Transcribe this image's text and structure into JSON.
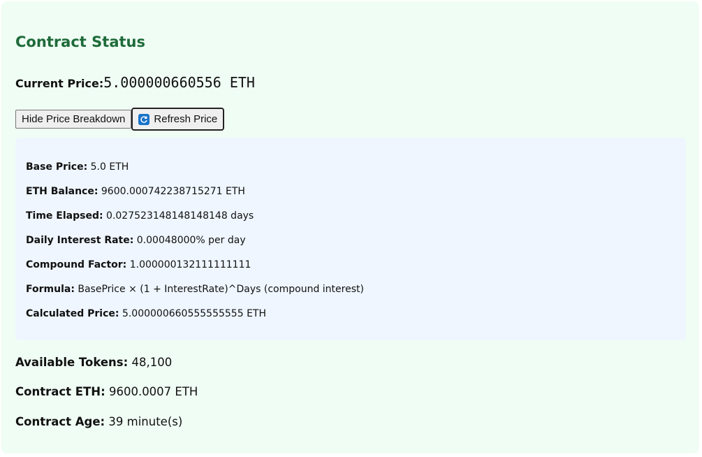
{
  "title": "Contract Status",
  "current_price": {
    "label": "Current Price:",
    "value": "5.000000660556 ETH"
  },
  "buttons": {
    "hide_breakdown": "Hide Price Breakdown",
    "refresh": "Refresh Price",
    "refresh_icon": "refresh-icon"
  },
  "breakdown": {
    "base_price": {
      "label": "Base Price:",
      "value": "5.0 ETH"
    },
    "eth_balance": {
      "label": "ETH Balance:",
      "value": "9600.000742238715271 ETH"
    },
    "time_elapsed": {
      "label": "Time Elapsed:",
      "value": "0.027523148148148148 days"
    },
    "daily_rate": {
      "label": "Daily Interest Rate:",
      "value": "0.00048000% per day"
    },
    "compound_factor": {
      "label": "Compound Factor:",
      "value": "1.000000132111111111"
    },
    "formula": {
      "label": "Formula:",
      "value": "BasePrice × (1 + InterestRate)^Days (compound interest)"
    },
    "calculated_price": {
      "label": "Calculated Price:",
      "value": "5.000000660555555555 ETH"
    }
  },
  "stats": {
    "available_tokens": {
      "label": "Available Tokens:",
      "value": "48,100"
    },
    "contract_eth": {
      "label": "Contract ETH:",
      "value": "9600.0007 ETH"
    },
    "contract_age": {
      "label": "Contract Age:",
      "value": "39 minute(s)"
    }
  },
  "colors": {
    "card_bg": "#f0fdf4",
    "title": "#1e6b3a",
    "breakdown_bg": "#eff6ff",
    "refresh_icon_bg": "#1a73c9"
  }
}
